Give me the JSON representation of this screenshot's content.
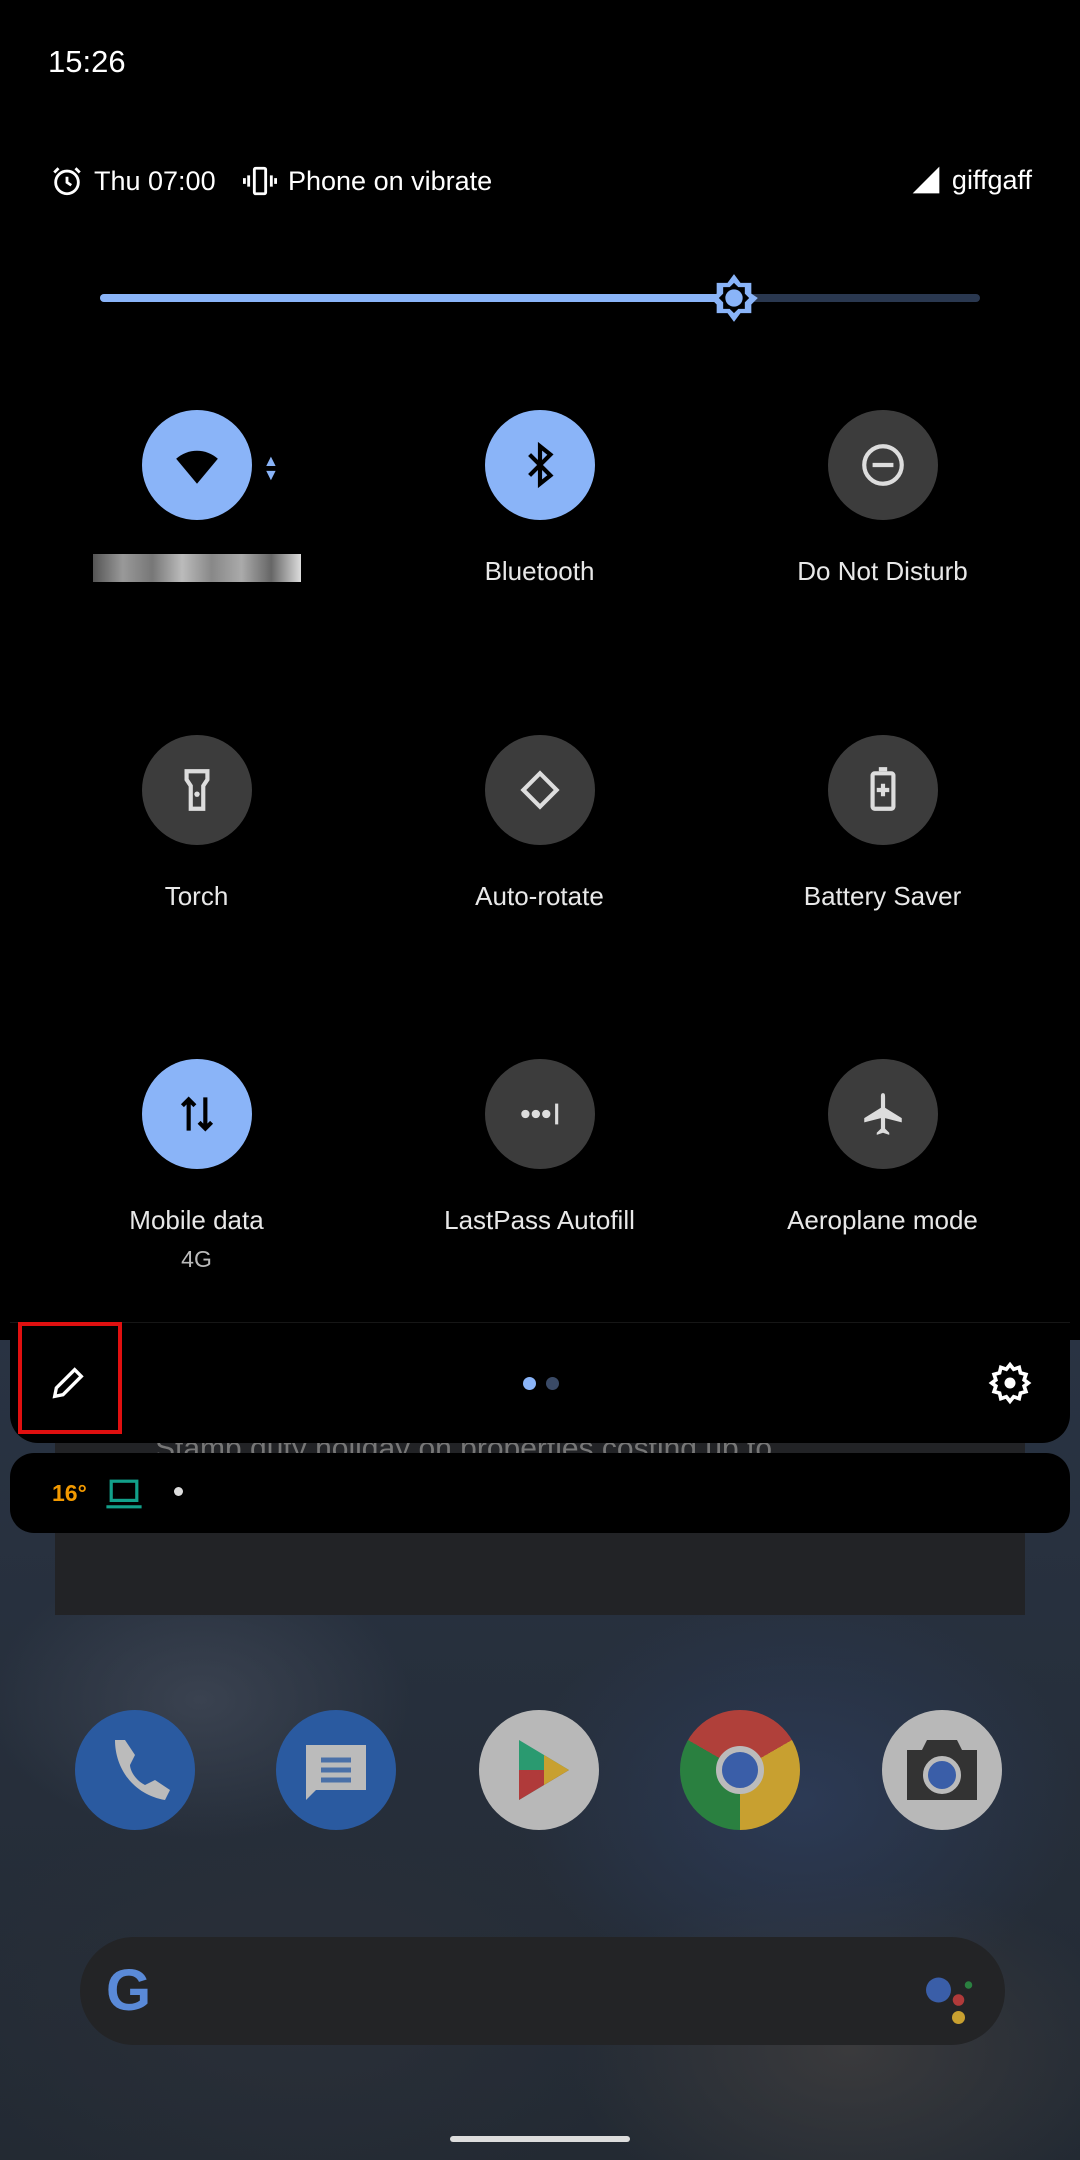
{
  "status_bar": {
    "time": "15:26"
  },
  "header": {
    "alarm_icon": "alarm-icon",
    "alarm": "Thu 07:00",
    "vibrate_icon": "vibrate-icon",
    "ringer": "Phone on vibrate",
    "signal_icon": "signal-icon",
    "carrier": "giffgaff"
  },
  "brightness": {
    "level": 0.72,
    "icon": "brightness-icon"
  },
  "tiles": [
    {
      "label": "",
      "active": true,
      "icon": "wifi-icon"
    },
    {
      "label": "Bluetooth",
      "active": true,
      "icon": "bluetooth-icon"
    },
    {
      "label": "Do Not Disturb",
      "active": false,
      "icon": "dnd-icon"
    },
    {
      "label": "Torch",
      "active": false,
      "icon": "torch-icon"
    },
    {
      "label": "Auto-rotate",
      "active": false,
      "icon": "rotate-icon"
    },
    {
      "label": "Battery Saver",
      "active": false,
      "icon": "battery-icon"
    },
    {
      "label": "Mobile data",
      "sub": "4G",
      "active": true,
      "icon": "mobile-data-icon"
    },
    {
      "label": "LastPass Autofill",
      "active": false,
      "icon": "lastpass-icon"
    },
    {
      "label": "Aeroplane mode",
      "active": false,
      "icon": "airplane-icon"
    }
  ],
  "footer": {
    "edit_icon": "pencil-icon",
    "settings_icon": "gear-icon",
    "pages": 2,
    "current_page": 1
  },
  "notification_strip": {
    "temperature": "16°",
    "device_icon": "laptop-icon"
  },
  "background_card": {
    "text": "Stamp duty holiday on properties costing up to"
  },
  "dock": [
    "phone",
    "messages",
    "play-store",
    "chrome",
    "camera"
  ],
  "colors": {
    "accent": "#8ab4f8",
    "tile_off": "#3c3c3c",
    "highlight": "#e01010",
    "temp": "#f29900",
    "device": "#12a08a"
  }
}
